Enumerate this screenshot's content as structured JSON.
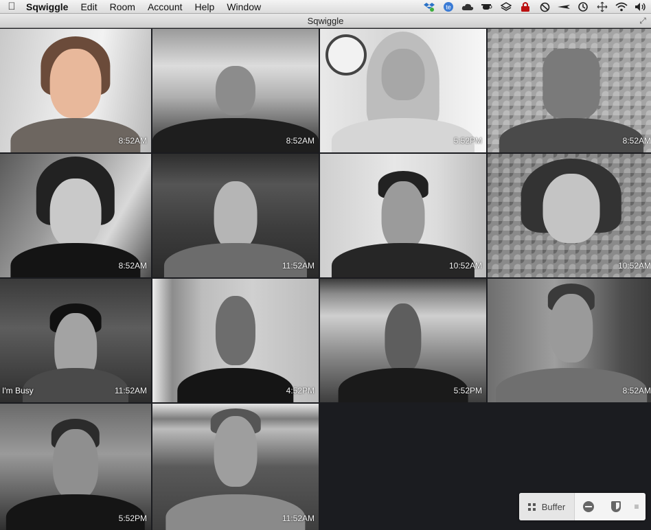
{
  "menubar": {
    "apple_icon": "apple-icon",
    "items": [
      "Sqwiggle",
      "Edit",
      "Room",
      "Account",
      "Help",
      "Window"
    ],
    "status_icons": [
      "dropbox-icon",
      "ie-icon",
      "cloud-icon",
      "teacup-icon",
      "layers-icon",
      "lock-icon",
      "no-entry-icon",
      "airplane-icon",
      "time-machine-icon",
      "move-icon",
      "wifi-icon",
      "volume-icon"
    ]
  },
  "window": {
    "title": "Sqwiggle",
    "resize_icon": "resize-icon"
  },
  "participants": [
    {
      "time": "8:52AM",
      "status": ""
    },
    {
      "time": "8:52AM",
      "status": ""
    },
    {
      "time": "5:52PM",
      "status": ""
    },
    {
      "time": "8:52AM",
      "status": ""
    },
    {
      "time": "8:52AM",
      "status": ""
    },
    {
      "time": "11:52AM",
      "status": ""
    },
    {
      "time": "10:52AM",
      "status": ""
    },
    {
      "time": "10:52AM",
      "status": ""
    },
    {
      "time": "11:52AM",
      "status": "I'm Busy"
    },
    {
      "time": "4:52PM",
      "status": ""
    },
    {
      "time": "5:52PM",
      "status": ""
    },
    {
      "time": "8:52AM",
      "status": ""
    },
    {
      "time": "5:52PM",
      "status": ""
    },
    {
      "time": "11:52AM",
      "status": ""
    }
  ],
  "toolbar": {
    "team_label": "Buffer",
    "team_icon": "grid-icon",
    "dnd_icon": "minus-circle-icon",
    "privacy_icon": "shield-icon",
    "more_icon": "more-icon"
  }
}
